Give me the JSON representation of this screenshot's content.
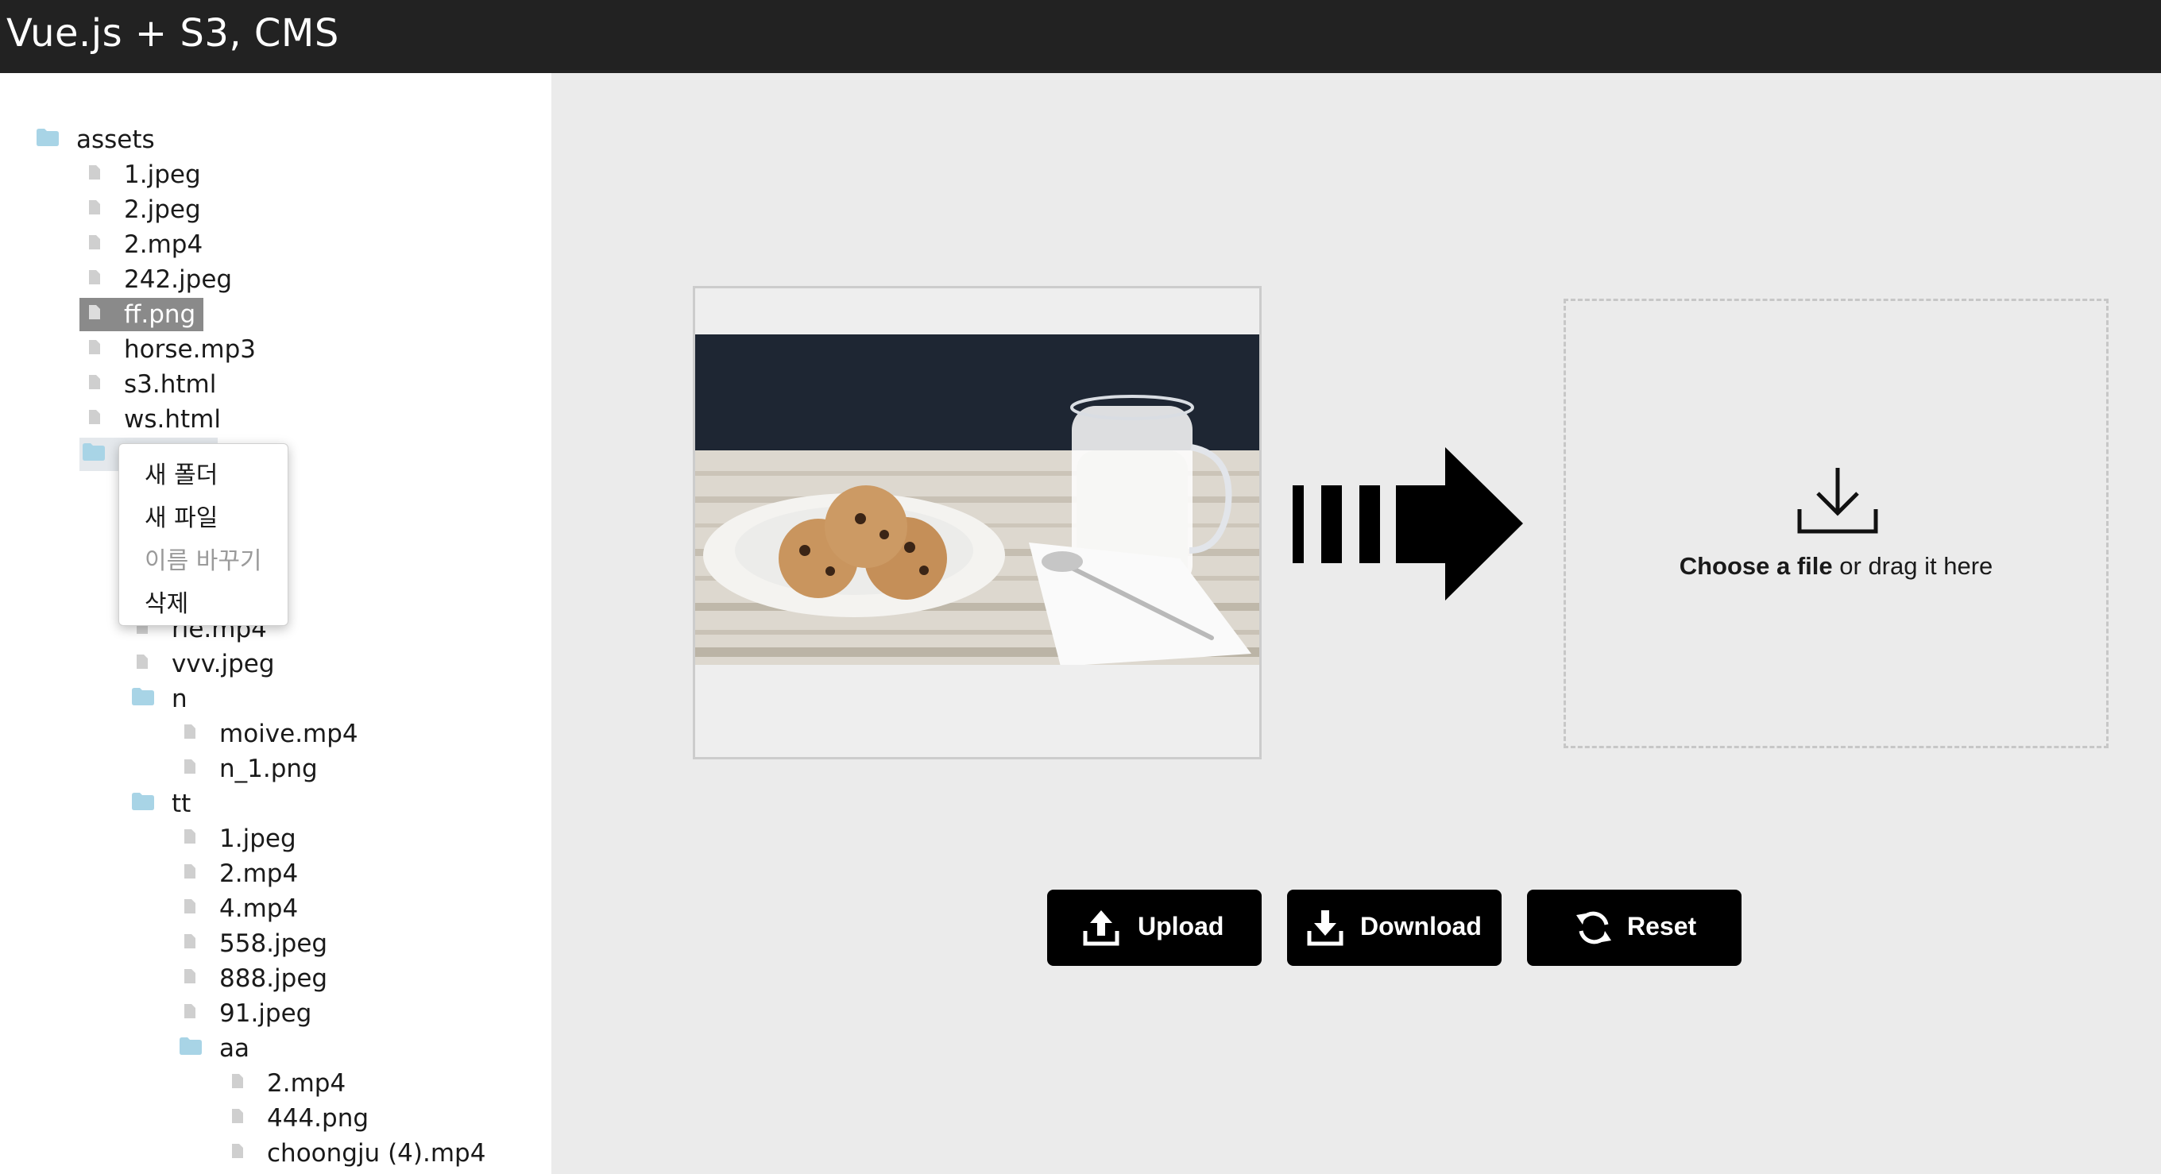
{
  "app": {
    "title": "Vue.js + S3, CMS"
  },
  "tree": {
    "root": "assets",
    "assets_files": [
      "1.jpeg",
      "2.jpeg",
      "2.mp4",
      "242.jpeg",
      "ff.png",
      "horse.mp3",
      "s3.html",
      "ws.html"
    ],
    "hidden_files": [
      "rie.mp4",
      "vvv.jpeg"
    ],
    "n_folder": "n",
    "n_files": [
      "moive.mp4",
      "n_1.png"
    ],
    "tt_folder": "tt",
    "tt_files": [
      "1.jpeg",
      "2.mp4",
      "4.mp4",
      "558.jpeg",
      "888.jpeg",
      "91.jpeg"
    ],
    "aa_folder": "aa",
    "aa_files": [
      "2.mp4",
      "444.png",
      "choongju (4).mp4"
    ],
    "selected": "ff.png"
  },
  "context_menu": {
    "new_folder": "새 폴더",
    "new_file": "새 파일",
    "rename": "이름 바꾸기",
    "delete": "삭제",
    "rename_disabled": true
  },
  "upload": {
    "drop_choose": "Choose a file",
    "drop_rest": " or drag it here"
  },
  "buttons": {
    "upload": "Upload",
    "download": "Download",
    "reset": "Reset"
  },
  "colors": {
    "topbar": "#222222",
    "folder_icon": "#a8d4e6",
    "file_icon": "#cfcfcf",
    "selected_bg": "#8a8a8a",
    "button_bg": "#000000"
  },
  "icons": {
    "folder": "folder-icon",
    "file": "file-icon",
    "drop": "download-tray-icon",
    "arrow": "right-arrow-icon",
    "upload": "upload-icon",
    "download": "download-icon",
    "reset": "refresh-icon"
  }
}
